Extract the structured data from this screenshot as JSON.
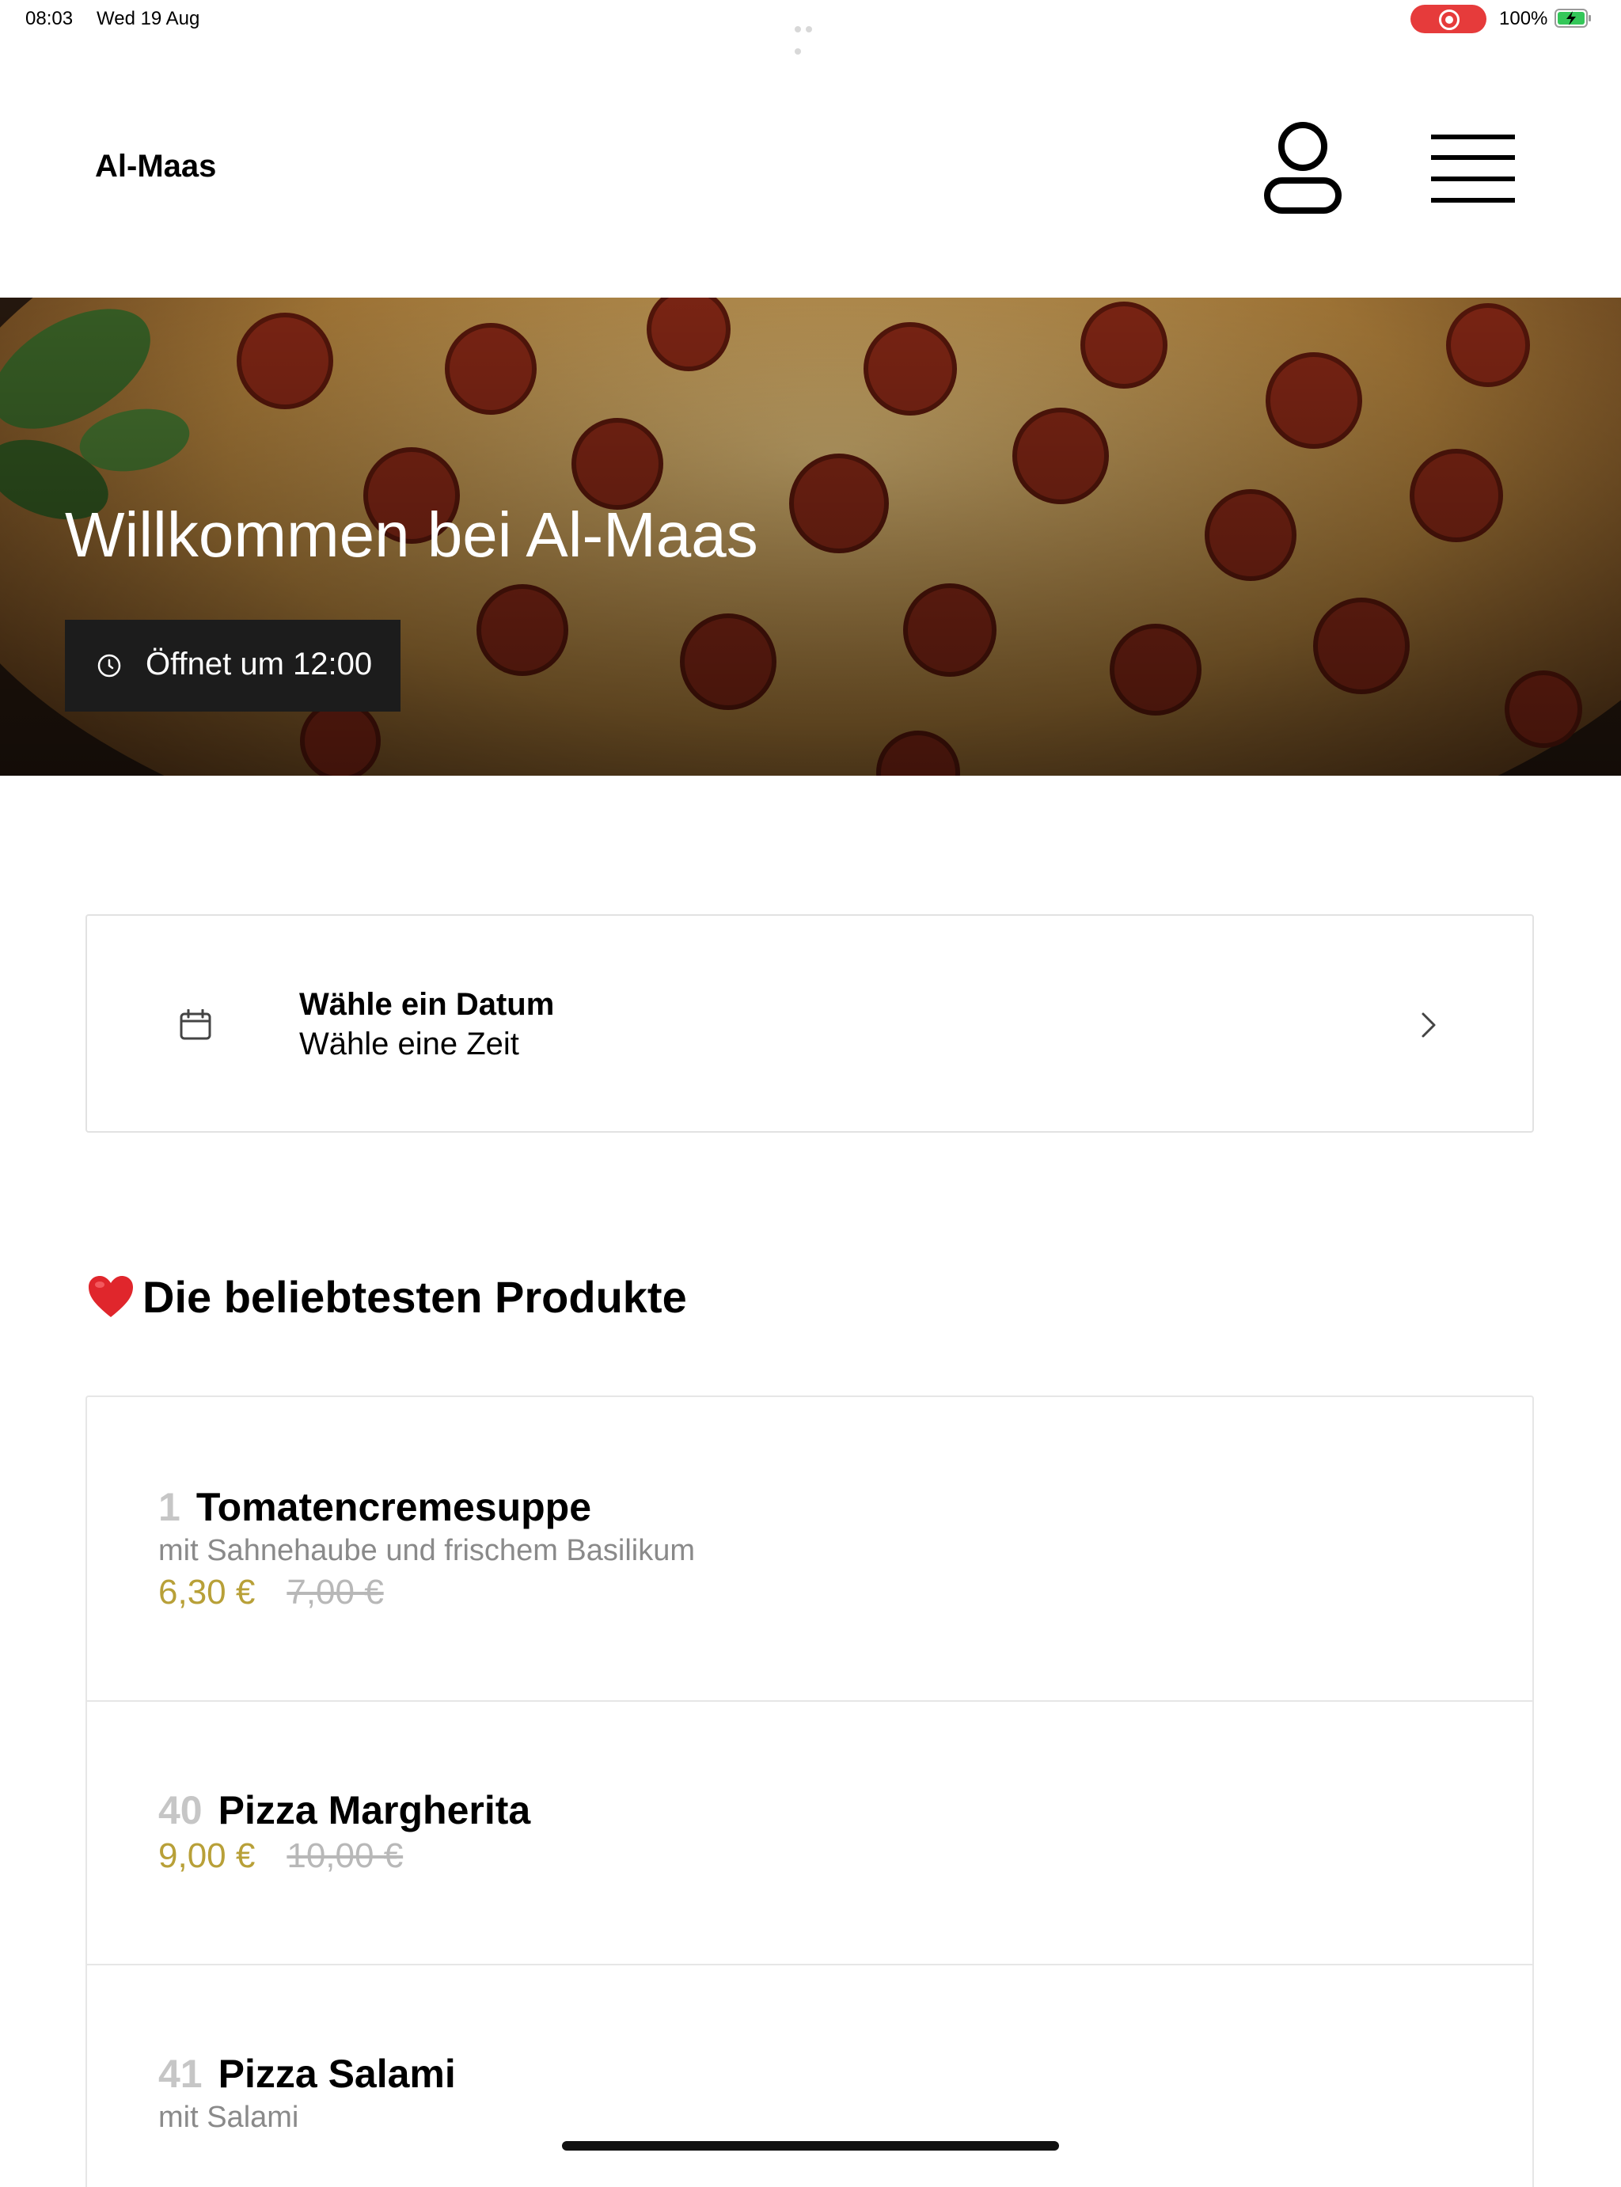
{
  "status_bar": {
    "time": "08:03",
    "date": "Wed 19 Aug",
    "battery": "100%"
  },
  "header": {
    "brand": "Al-Maas",
    "user_icon": "user-icon",
    "menu_icon": "hamburger-menu-icon"
  },
  "hero": {
    "title": "Willkommen bei Al-Maas",
    "hours": "Öffnet um 12:00",
    "hours_icon": "clock-icon"
  },
  "date_picker": {
    "line1": "Wähle ein Datum",
    "line2": "Wähle eine Zeit",
    "icon": "calendar-icon",
    "chevron": "chevron-right-icon"
  },
  "popular": {
    "heading": "Die beliebtesten Produkte",
    "heading_icon": "heart-icon",
    "items": [
      {
        "number": "1",
        "name": "Tomatencremesuppe",
        "description": "mit Sahnehaube und frischem Basilikum",
        "price": "6,30 €",
        "old_price": "7,00 €"
      },
      {
        "number": "40",
        "name": "Pizza Margherita",
        "price": "9,00 €",
        "old_price": "10,00 €"
      },
      {
        "number": "41",
        "name": "Pizza Salami",
        "description": "mit Salami"
      }
    ]
  },
  "colors": {
    "price_accent": "#b8a038",
    "recording_indicator": "#e63b3b",
    "hours_badge_bg": "#1c1c1c"
  }
}
